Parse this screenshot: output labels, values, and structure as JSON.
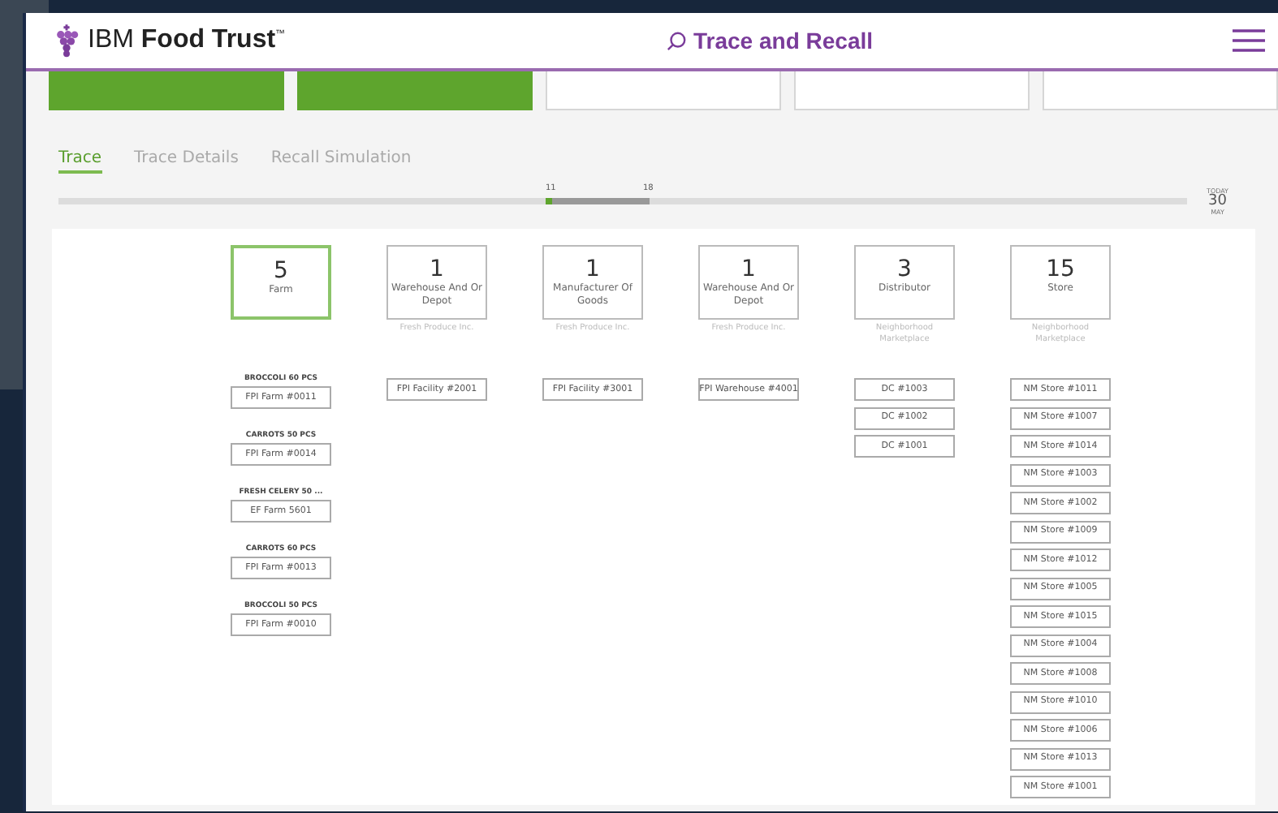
{
  "header": {
    "logo": "IBM **Food Trust**$^{™}$",
    "title": "Trace and Recall"
  },
  "summary_cards": [
    {
      "filled": true
    },
    {
      "filled": true
    },
    {
      "filled": false
    },
    {
      "filled": false
    },
    {
      "filled": false
    }
  ],
  "tabs": [
    {
      "label": "Trace",
      "selected": true
    },
    {
      "label": "Trace Details",
      "selected": false
    },
    {
      "label": "Recall Simulation",
      "selected": false
    }
  ],
  "timeline": {
    "range_start": "11",
    "range_end": "18",
    "today_label": "TODAY",
    "today_day": "30",
    "today_month": "MAY"
  },
  "stages": [
    {
      "count": "5",
      "name": "Farm",
      "selected": true,
      "lots": [
        {
          "product": "BROCCOLI 60 PCS",
          "location": "FPI Farm #0011"
        },
        {
          "product": "CARROTS 50 PCS",
          "location": "FPI Farm #0014"
        },
        {
          "product": "FRESH CELERY 50 ...",
          "location": "EF Farm 5601"
        },
        {
          "product": "CARROTS 60 PCS",
          "location": "FPI Farm #0013"
        },
        {
          "product": "BROCCOLI 50 PCS",
          "location": "FPI Farm #0010"
        }
      ]
    },
    {
      "count": "1",
      "name": "Warehouse And Or Depot",
      "selected": false,
      "company": "Fresh Produce Inc.",
      "lots": [
        {
          "location": "FPI Facility #2001"
        }
      ]
    },
    {
      "count": "1",
      "name": "Manufacturer Of Goods",
      "selected": false,
      "company": "Fresh Produce Inc.",
      "lots": [
        {
          "location": "FPI Facility #3001"
        }
      ]
    },
    {
      "count": "1",
      "name": "Warehouse And Or Depot",
      "selected": false,
      "company": "Fresh Produce Inc.",
      "lots": [
        {
          "location": "FPI Warehouse #4001"
        }
      ]
    },
    {
      "count": "3",
      "name": "Distributor",
      "selected": false,
      "company": "Neighborhood Marketplace",
      "lots": [
        {
          "location": "DC #1003"
        },
        {
          "location": "DC #1002"
        },
        {
          "location": "DC #1001"
        }
      ]
    },
    {
      "count": "15",
      "name": "Store",
      "selected": false,
      "company": "Neighborhood Marketplace",
      "lots": [
        {
          "location": "NM Store #1011"
        },
        {
          "location": "NM Store #1007"
        },
        {
          "location": "NM Store #1014"
        },
        {
          "location": "NM Store #1003"
        },
        {
          "location": "NM Store #1002"
        },
        {
          "location": "NM Store #1009"
        },
        {
          "location": "NM Store #1012"
        },
        {
          "location": "NM Store #1005"
        },
        {
          "location": "NM Store #1015"
        },
        {
          "location": "NM Store #1004"
        },
        {
          "location": "NM Store #1008"
        },
        {
          "location": "NM Store #1010"
        },
        {
          "location": "NM Store #1006"
        },
        {
          "location": "NM Store #1013"
        },
        {
          "location": "NM Store #1001"
        }
      ]
    }
  ]
}
